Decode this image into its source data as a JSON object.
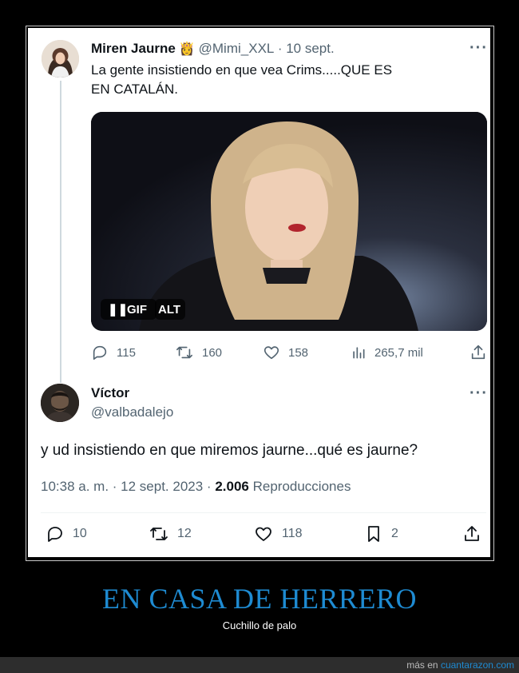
{
  "tweet1": {
    "display_name": "Miren Jaurne",
    "emoji": "👸",
    "handle": "@Mimi_XXL",
    "date": "· 10 sept.",
    "text": "La gente insistiendo en que vea Crims.....QUE ES EN CATALÁN.",
    "media": {
      "gif_label": "GIF",
      "alt_label": "ALT"
    },
    "stats": {
      "replies": "115",
      "retweets": "160",
      "likes": "158",
      "views": "265,7 mil"
    }
  },
  "tweet2": {
    "display_name": "Víctor",
    "handle": "@valbadalejo",
    "text": "y ud insistiendo en que miremos jaurne...qué es jaurne?",
    "meta": {
      "time": "10:38 a. m. · 12 sept. 2023 ·",
      "views_count": "2.006",
      "views_label": "Reproducciones"
    },
    "stats": {
      "replies": "10",
      "retweets": "12",
      "likes": "118",
      "bookmarks": "2"
    }
  },
  "banner": {
    "title": "EN CASA DE HERRERO",
    "subtitle": "Cuchillo de palo"
  },
  "footer": {
    "prefix": "más en",
    "site": "cuantarazon.com"
  },
  "colors": {
    "accent": "#1e8bd2",
    "text": "#0f1419",
    "muted": "#536471"
  }
}
